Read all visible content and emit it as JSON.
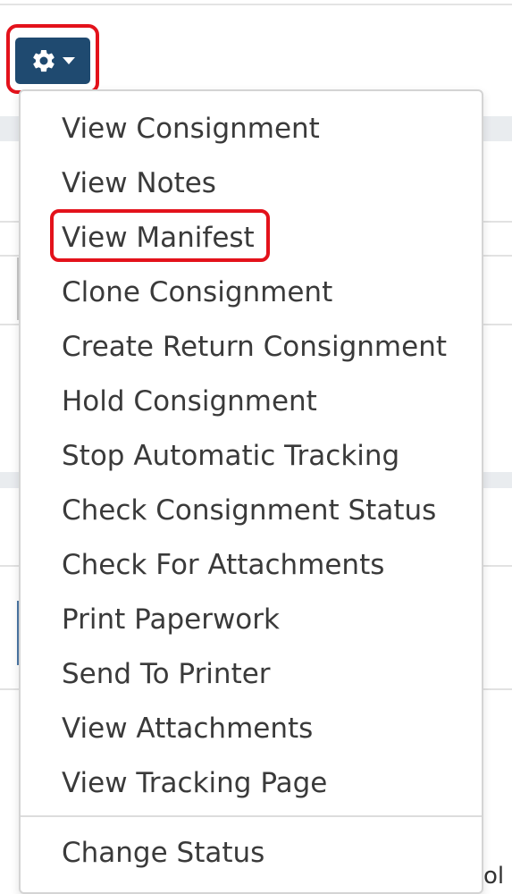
{
  "toolbar": {
    "gear_button": {
      "icon": "gear-icon",
      "caret": "caret-down-icon",
      "color": "#1f4a70"
    }
  },
  "highlight_color": "#e3121b",
  "menu": {
    "items": [
      {
        "label": "View Consignment"
      },
      {
        "label": "View Notes"
      },
      {
        "label": "View Manifest",
        "highlighted": true
      },
      {
        "label": "Clone Consignment"
      },
      {
        "label": "Create Return Consignment"
      },
      {
        "label": "Hold Consignment"
      },
      {
        "label": "Stop Automatic Tracking"
      },
      {
        "label": "Check Consignment Status"
      },
      {
        "label": "Check For Attachments"
      },
      {
        "label": "Print Paperwork"
      },
      {
        "label": "Send To Printer"
      },
      {
        "label": "View Attachments"
      },
      {
        "label": "View Tracking Page"
      }
    ],
    "footer_items": [
      {
        "label": "Change Status"
      }
    ]
  },
  "background": {
    "peek_text": "ol"
  }
}
